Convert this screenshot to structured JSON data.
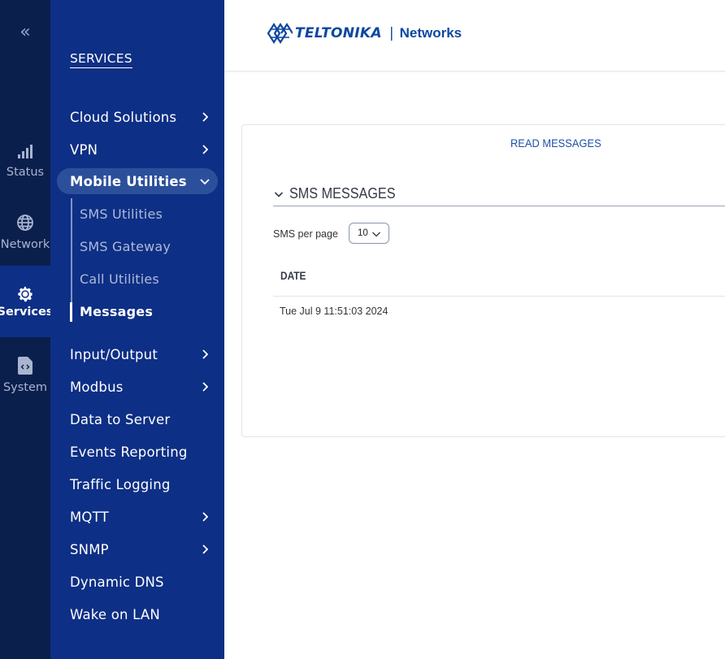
{
  "rail": {
    "collapse_glyph": "«",
    "items": [
      {
        "label": "Status",
        "icon": "signal-bars-icon"
      },
      {
        "label": "Network",
        "icon": "globe-icon"
      },
      {
        "label": "Services",
        "icon": "gear-icon",
        "active": true
      },
      {
        "label": "System",
        "icon": "file-code-icon"
      }
    ]
  },
  "menu": {
    "title": "SERVICES",
    "items": [
      {
        "label": "Cloud Solutions",
        "has_children": true
      },
      {
        "label": "VPN",
        "has_children": true
      },
      {
        "label": "Mobile Utilities",
        "expanded": true
      },
      {
        "label": "Input/Output",
        "has_children": true
      },
      {
        "label": "Modbus",
        "has_children": true
      },
      {
        "label": "Data to Server"
      },
      {
        "label": "Events Reporting"
      },
      {
        "label": "Traffic Logging"
      },
      {
        "label": "MQTT",
        "has_children": true
      },
      {
        "label": "SNMP",
        "has_children": true
      },
      {
        "label": "Dynamic DNS"
      },
      {
        "label": "Wake on LAN"
      }
    ],
    "subitems": [
      {
        "label": "SMS Utilities"
      },
      {
        "label": "SMS Gateway"
      },
      {
        "label": "Call Utilities"
      },
      {
        "label": "Messages",
        "active": true
      }
    ]
  },
  "header": {
    "brand": "TELTONIKA",
    "separator": "|",
    "sub": "Networks"
  },
  "card": {
    "tab": "READ MESSAGES",
    "section_title": "SMS MESSAGES",
    "per_page_label": "SMS per page",
    "per_page_value": "10",
    "table": {
      "headers": [
        "DATE"
      ],
      "rows": [
        [
          "Tue Jul 9 11:51:03 2024"
        ]
      ]
    }
  },
  "colors": {
    "rail_bg": "#0b1f4d",
    "menu_bg": "#0d2f85",
    "accent": "#0d47a1",
    "expanded_bg": "#2c4f9b"
  }
}
